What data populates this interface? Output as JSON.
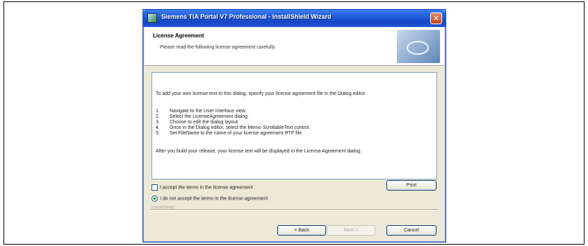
{
  "window": {
    "title": "Siemens TIA Portal V7 Professional - InstallShield Wizard",
    "close_glyph": "✕"
  },
  "header": {
    "title": "License Agreement",
    "subtitle": "Please read the following license agreement carefully."
  },
  "license": {
    "intro": "To add your own license text to this dialog, specify your license agreement file in the Dialog editor.",
    "steps": [
      {
        "num": "1.",
        "text": "Navigate to the User Interface view."
      },
      {
        "num": "2.",
        "text": "Select the LicenseAgreement dialog."
      },
      {
        "num": "3.",
        "text": "Choose to edit the dialog layout."
      },
      {
        "num": "4.",
        "text": "Once in the Dialog editor, select the Memo ScrollableText control."
      },
      {
        "num": "5.",
        "text": "Set FileName to the name of your license agreement RTF file."
      }
    ],
    "outro": "After you build your release, your license text will be displayed in the License Agreement dialog."
  },
  "options": {
    "accept": "I accept the terms in the license agreement",
    "decline": "I do not accept the terms in the license agreement"
  },
  "buttons": {
    "print": "Print",
    "back": "< Back",
    "next": "Next >",
    "cancel": "Cancel"
  },
  "footer": {
    "brand": "InstallShield"
  }
}
